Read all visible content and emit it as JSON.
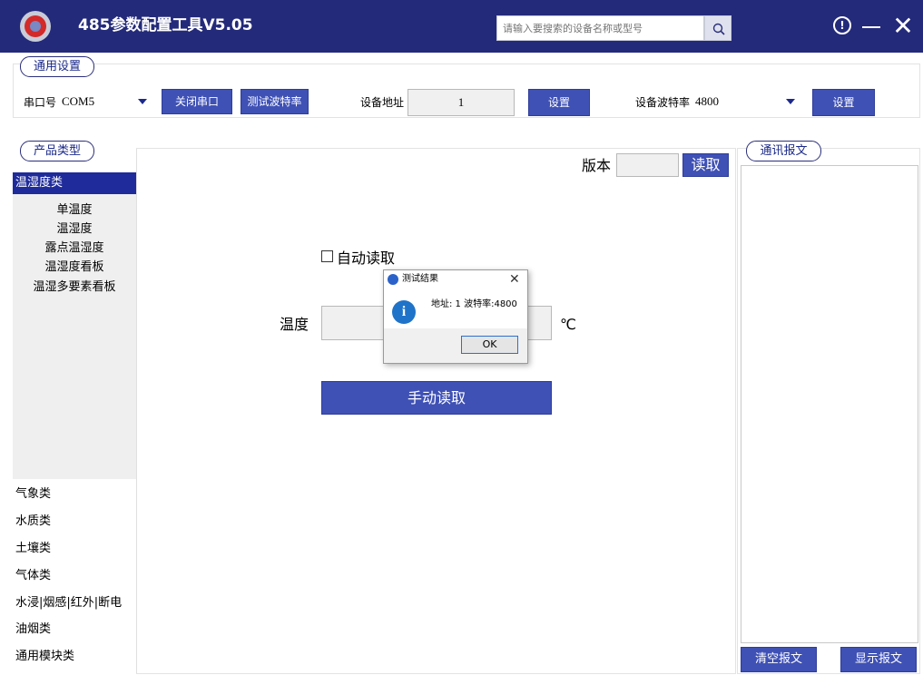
{
  "app": {
    "title": "485参数配置工具V5.05",
    "search_placeholder": "请输入要搜索的设备名称或型号",
    "icons": [
      "logo-icon",
      "search-icon",
      "info-icon",
      "minimize-icon",
      "close-icon"
    ]
  },
  "general": {
    "label": "通用设置",
    "port_label": "串口号",
    "port_value": "COM5",
    "close_port": "关闭串口",
    "test_baud": "测试波特率",
    "addr_label": "设备地址",
    "addr_value": "1",
    "addr_set": "设置",
    "baud_label": "设备波特率",
    "baud_value": "4800",
    "baud_set": "设置"
  },
  "product": {
    "label": "产品类型",
    "selected_category": "温湿度类",
    "sub_items": [
      "单温度",
      "温湿度",
      "露点温湿度",
      "温湿度看板",
      "温湿多要素看板"
    ],
    "categories": [
      "气象类",
      "水质类",
      "土壤类",
      "气体类",
      "水浸|烟感|红外|断电",
      "油烟类",
      "通用模块类"
    ]
  },
  "main": {
    "version_label": "版本",
    "read_button": "读取",
    "auto_read": "自动读取",
    "temp_label": "温度",
    "temp_unit": "℃",
    "manual_read": "手动读取"
  },
  "dialog": {
    "title": "测试结果",
    "message": "地址: 1  波特率:4800",
    "ok": "OK",
    "close": "✕",
    "info_glyph": "i"
  },
  "comm": {
    "label": "通讯报文",
    "clear": "清空报文",
    "show": "显示报文"
  },
  "colors": {
    "titlebar": "#242a7a",
    "button": "#3f51b5",
    "selected": "#1f2b9a"
  }
}
